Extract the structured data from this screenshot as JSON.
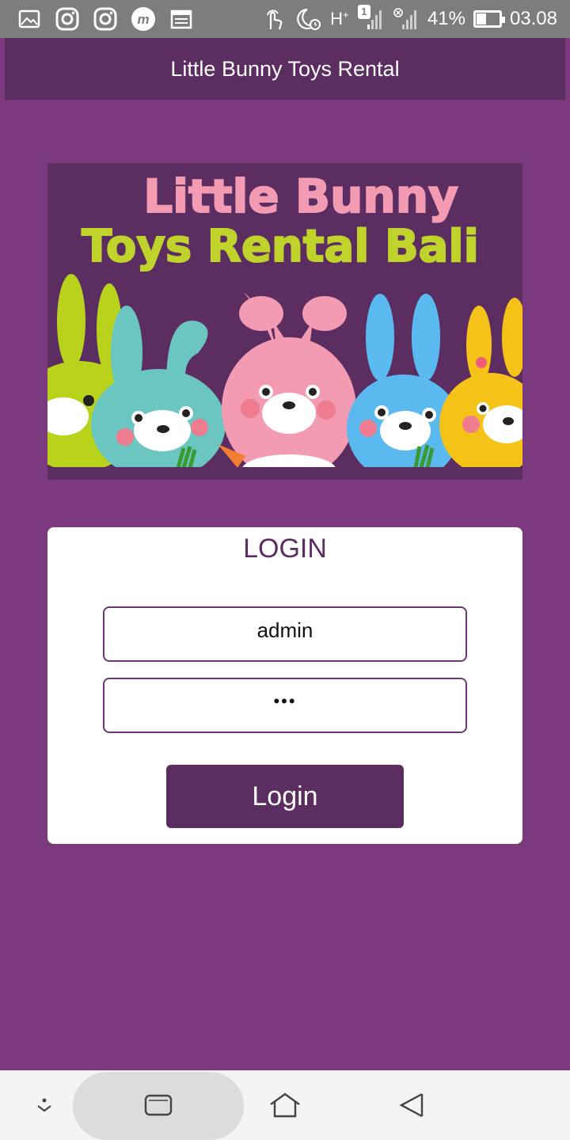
{
  "status_bar": {
    "left_icons": [
      "gallery-icon",
      "instagram-icon",
      "instagram-icon",
      "messenger-icon",
      "calendar-icon"
    ],
    "right_icons": [
      "touch-icon",
      "do-not-disturb-alarm-icon",
      "network-h-plus-icon",
      "sim-1-signal-icon",
      "no-signal-icon"
    ],
    "network_label": "H",
    "sim_badge": "1",
    "battery_percent": "41%",
    "battery_level": 0.41,
    "time": "03.08"
  },
  "app_bar": {
    "title": "Little Bunny Toys Rental"
  },
  "banner": {
    "line1": "Little Bunny",
    "line2": "Toys Rental Bali",
    "colors": {
      "background": "#5c2d61",
      "line1": "#f29bb2",
      "line2": "#bfd32a"
    }
  },
  "login": {
    "title": "LOGIN",
    "username_value": "admin",
    "password_value": "•••",
    "button_label": "Login"
  },
  "nav_bar": {
    "buttons": [
      "hide-keyboard-icon",
      "recent-apps-icon",
      "home-icon",
      "back-icon"
    ]
  },
  "colors": {
    "accent": "#5c2d61",
    "page_background": "#7b3a7e",
    "status_bar": "#7d7d7d"
  }
}
